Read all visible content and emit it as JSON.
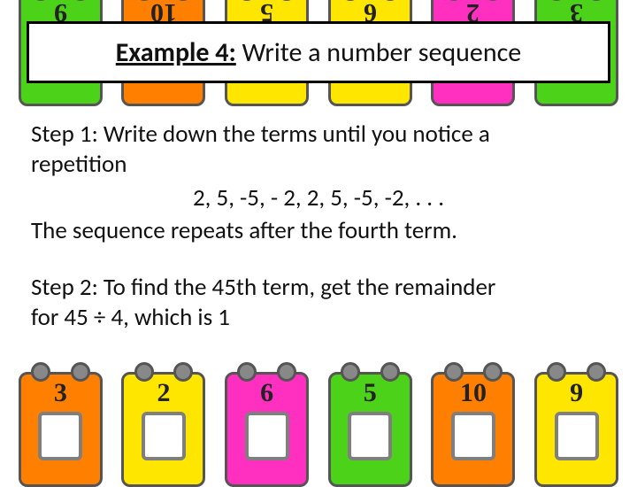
{
  "heading": {
    "example_label": "Example 4:",
    "title_rest": " Write a number sequence"
  },
  "steps": {
    "s1_line1": "Step 1: Write down the terms until you notice a",
    "s1_line2": "repetition",
    "sequence": "2, 5, -5, - 2, 2, 5, -5, -2, . . .",
    "s1_concl": "The sequence repeats after the fourth term.",
    "s2_line1": "Step 2: To find the 45th term, get the remainder",
    "s2_line2": "for 45 ÷ 4, which is 1"
  },
  "toys_top": [
    "9",
    "10",
    "5",
    "6",
    "2",
    "3"
  ],
  "toys_bottom": [
    "3",
    "2",
    "6",
    "5",
    "10",
    "9"
  ]
}
